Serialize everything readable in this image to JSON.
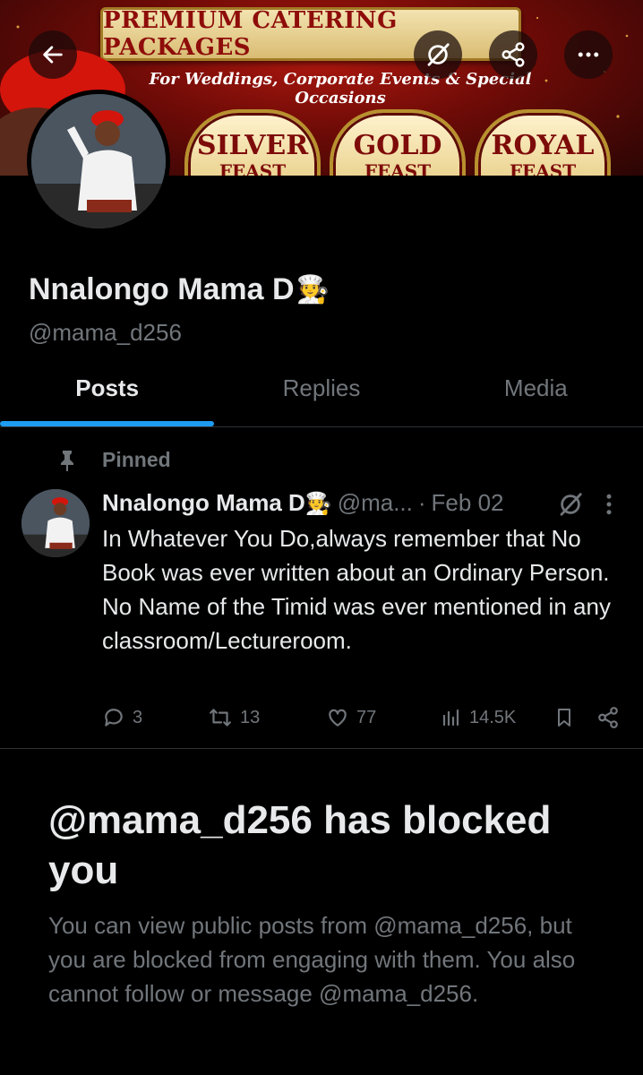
{
  "header": {
    "back_icon": "arrow-left-icon",
    "grok_icon": "grok-icon",
    "share_icon": "share-icon",
    "more_icon": "more-horizontal-icon"
  },
  "banner": {
    "title": "PREMIUM CATERING PACKAGES",
    "subtitle": "For Weddings, Corporate Events & Special Occasions",
    "packages": [
      {
        "name": "SILVER",
        "suffix": "FEAST"
      },
      {
        "name": "GOLD",
        "suffix": "FEAST"
      },
      {
        "name": "ROYAL",
        "suffix": "FEAST"
      }
    ]
  },
  "profile": {
    "display_name": "Nnalongo Mama D",
    "name_emoji": "🧑‍🍳",
    "handle": "@mama_d256"
  },
  "tabs": [
    {
      "label": "Posts",
      "active": true
    },
    {
      "label": "Replies",
      "active": false
    },
    {
      "label": "Media",
      "active": false
    }
  ],
  "pinned_post": {
    "pinned_label": "Pinned",
    "author_name": "Nnalongo Mama D",
    "author_emoji": "🧑‍🍳",
    "author_handle": "@ma...",
    "separator": "·",
    "date": "Feb 02",
    "text_lines": [
      "In Whatever You Do,always remember that No Book was ever written about an Ordinary Person.",
      "No Name of the Timid was ever mentioned in any classroom/Lectureroom."
    ],
    "stats": {
      "replies": "3",
      "reposts": "13",
      "likes": "77",
      "views": "14.5K"
    }
  },
  "blocked_notice": {
    "title": "@mama_d256 has blocked you",
    "description": "You can view public posts from @mama_d256, but you are blocked from engaging with them. You also cannot follow or message @mama_d256."
  },
  "colors": {
    "background": "#000000",
    "text_primary": "#e7e9ea",
    "text_secondary": "#71767b",
    "accent": "#1d9bf0",
    "divider": "#2f3336"
  }
}
